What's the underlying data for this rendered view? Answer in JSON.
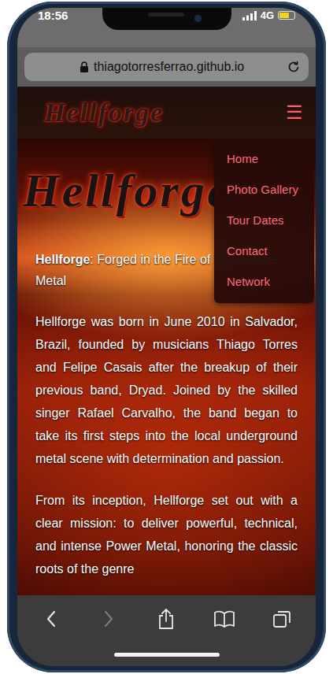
{
  "status_bar": {
    "time": "18:56",
    "network": "4G",
    "battery_level": 0.65
  },
  "address_bar": {
    "url": "thiagotorresferrao.github.io"
  },
  "header": {
    "logo": "Hellforge",
    "menu_icon": "☰"
  },
  "menu": {
    "expanded": true,
    "items": [
      {
        "label": "Home"
      },
      {
        "label": "Photo Gallery"
      },
      {
        "label": "Tour Dates"
      },
      {
        "label": "Contact"
      },
      {
        "label": "Network"
      }
    ]
  },
  "hero": {
    "title": "Hellforge"
  },
  "tagline": {
    "name": "Hellforge",
    "text": ": Forged in the Fire of Pure Power Metal"
  },
  "paragraphs": [
    "Hellforge was born in June 2010 in Salvador, Brazil, founded by musicians Thiago Torres and Felipe Casais after the breakup of their previous band, Dryad. Joined by the skilled singer Rafael Carvalho, the band began to take its first steps into the local underground metal scene with determination and passion.",
    "From its inception, Hellforge set out with a clear mission: to deliver powerful, technical, and intense Power Metal, honoring the classic roots of the genre"
  ],
  "toolbar": {
    "back_enabled": true,
    "forward_enabled": false
  }
}
